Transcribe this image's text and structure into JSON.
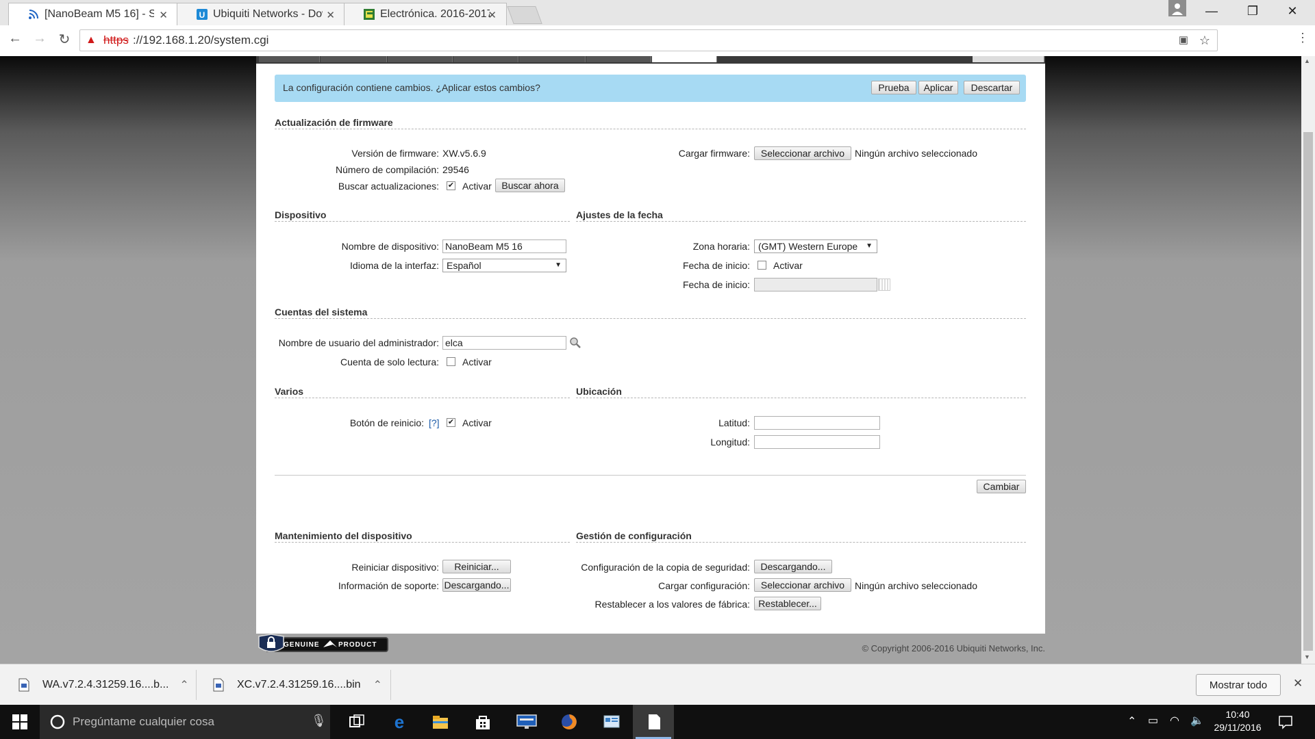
{
  "browser": {
    "tabs": [
      {
        "label": "[NanoBeam M5 16] - Sistema",
        "active": true
      },
      {
        "label": "Ubiquiti Networks - Downloads",
        "active": false
      },
      {
        "label": "Electrónica. 2016-2017",
        "active": false
      }
    ],
    "url_scheme": "https",
    "url_rest": "://192.168.1.20/system.cgi"
  },
  "alert": {
    "text": "La configuración contiene cambios. ¿Aplicar estos cambios?",
    "test_label": "Prueba",
    "apply_label": "Aplicar",
    "discard_label": "Descartar"
  },
  "firmware": {
    "title": "Actualización de firmware",
    "version_label": "Versión de firmware:",
    "version": "XW.v5.6.9",
    "build_label": "Número de compilación:",
    "build": "29546",
    "check_label": "Buscar actualizaciones:",
    "check_enabled": true,
    "check_enable_text": "Activar",
    "check_now_label": "Buscar ahora",
    "upload_label": "Cargar firmware:",
    "select_file_label": "Seleccionar archivo",
    "no_file_text": "Ningún archivo seleccionado"
  },
  "device": {
    "title": "Dispositivo",
    "name_label": "Nombre de dispositivo:",
    "name": "NanoBeam M5 16",
    "language_label": "Idioma de la interfaz:",
    "language": "Español"
  },
  "date": {
    "title": "Ajustes de la fecha",
    "timezone_label": "Zona horaria:",
    "timezone": "(GMT) Western Europe",
    "startup_label": "Fecha de inicio:",
    "startup_enabled": false,
    "startup_enable_text": "Activar",
    "startup_date_label": "Fecha de inicio:",
    "startup_date": ""
  },
  "accounts": {
    "title": "Cuentas del sistema",
    "admin_label": "Nombre de usuario del administrador:",
    "admin": "elca",
    "readonly_label": "Cuenta de solo lectura:",
    "readonly_enabled": false,
    "readonly_enable_text": "Activar"
  },
  "misc": {
    "title": "Varios",
    "reset_label": "Botón de reinicio:",
    "reset_help": "[?]",
    "reset_enabled": true,
    "reset_enable_text": "Activar"
  },
  "location": {
    "title": "Ubicación",
    "lat_label": "Latitud:",
    "lat": "",
    "lon_label": "Longitud:",
    "lon": ""
  },
  "change_label": "Cambiar",
  "maintenance": {
    "title": "Mantenimiento del dispositivo",
    "reboot_label": "Reiniciar dispositivo:",
    "reboot_button": "Reiniciar...",
    "support_label": "Información de soporte:",
    "support_button": "Descargando..."
  },
  "config": {
    "title": "Gestión de configuración",
    "backup_label": "Configuración de la copia de seguridad:",
    "backup_button": "Descargando...",
    "upload_label": "Cargar configuración:",
    "select_file_label": "Seleccionar archivo",
    "no_file_text": "Ningún archivo seleccionado",
    "reset_label": "Restablecer a los valores de fábrica:",
    "reset_button": "Restablecer..."
  },
  "footer": {
    "badge_left": "GENUINE",
    "badge_right": "PRODUCT",
    "copyright": "© Copyright 2006-2016 Ubiquiti Networks, Inc."
  },
  "downloads": {
    "items": [
      "WA.v7.2.4.31259.16....b...",
      "XC.v7.2.4.31259.16....bin"
    ],
    "show_all_label": "Mostrar todo"
  },
  "taskbar": {
    "search_placeholder": "Pregúntame cualquier cosa",
    "time": "10:40",
    "date": "29/11/2016"
  },
  "colors": {
    "alert_bg": "#a7daf3",
    "url_warning": "#d01919",
    "taskbar_bg": "#101010",
    "edge_blue": "#1e74d0"
  }
}
